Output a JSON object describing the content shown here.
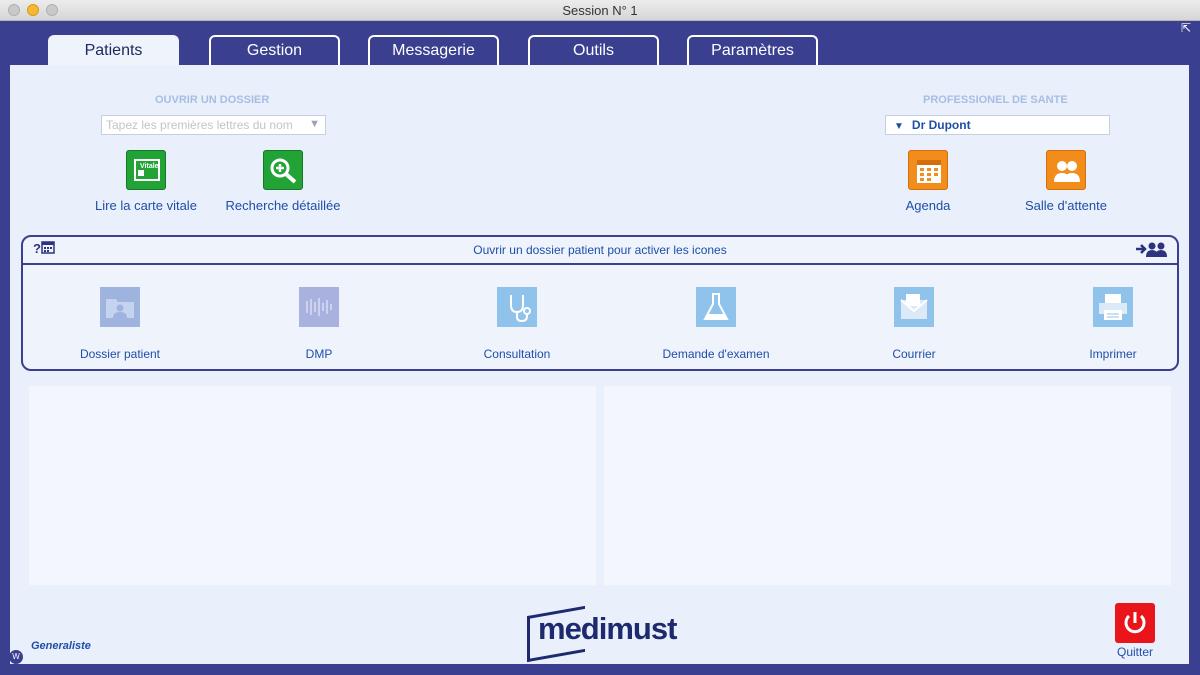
{
  "window": {
    "title": "Session N° 1"
  },
  "tabs": [
    {
      "label": "Patients",
      "active": true
    },
    {
      "label": "Gestion"
    },
    {
      "label": "Messagerie"
    },
    {
      "label": "Outils"
    },
    {
      "label": "Paramètres"
    }
  ],
  "open_file": {
    "title": "OUVRIR UN DOSSIER",
    "search_placeholder": "Tapez les premières lettres du nom",
    "actions": [
      {
        "label": "Lire la carte vitale",
        "icon": "vitale-card-icon"
      },
      {
        "label": "Recherche détaillée",
        "icon": "search-zoom-icon"
      }
    ]
  },
  "health_pro": {
    "title": "PROFESSIONEL DE SANTE",
    "selected": "Dr Dupont",
    "actions": [
      {
        "label": "Agenda",
        "icon": "calendar-icon"
      },
      {
        "label": "Salle d'attente",
        "icon": "waiting-room-icon"
      }
    ]
  },
  "patient_panel": {
    "message": "Ouvrir un dossier patient pour activer les icones",
    "left_icon": "?📅",
    "tools": [
      {
        "label": "Dossier patient",
        "icon": "patient-folder-icon"
      },
      {
        "label": "DMP",
        "icon": "dmp-icon"
      },
      {
        "label": "Consultation",
        "icon": "stethoscope-icon"
      },
      {
        "label": "Demande d'examen",
        "icon": "flask-icon"
      },
      {
        "label": "Courrier",
        "icon": "mail-icon"
      },
      {
        "label": "Imprimer",
        "icon": "printer-icon"
      }
    ]
  },
  "footer": {
    "profile": "Generaliste",
    "logo": "medimust",
    "badge": "W",
    "quit_label": "Quitter"
  },
  "colors": {
    "frame": "#3b3f8f",
    "content": "#e9f0fb",
    "link": "#1f4ea8",
    "green": "#21a336",
    "orange": "#f28c1a",
    "red": "#e9151b"
  }
}
